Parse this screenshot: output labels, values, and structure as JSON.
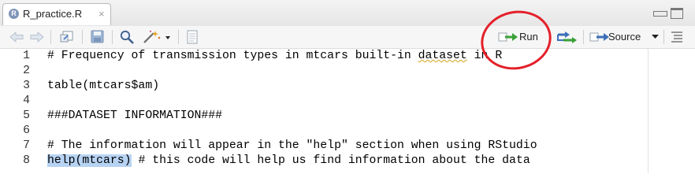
{
  "tab": {
    "filename": "R_practice.R",
    "close_glyph": "×",
    "icon_letter": "R"
  },
  "toolbar": {
    "run_label": "Run",
    "source_label": "Source"
  },
  "editor": {
    "lines": [
      {
        "num": "1",
        "pre": "# Frequency of transmission types in mtcars built-in ",
        "flag": "dataset",
        "post": " in R"
      },
      {
        "num": "2",
        "text": ""
      },
      {
        "num": "3",
        "text": "table(mtcars$am)"
      },
      {
        "num": "4",
        "text": ""
      },
      {
        "num": "5",
        "text": "###DATASET INFORMATION###"
      },
      {
        "num": "6",
        "text": ""
      },
      {
        "num": "7",
        "text": "# The information will appear in the \"help\" section when using RStudio"
      },
      {
        "num": "8",
        "sel": "help(mtcars)",
        "post": " # this code will help us find information about the data"
      }
    ]
  },
  "colors": {
    "annotation": "#e4202a",
    "selection": "#b7d3f3",
    "spell_underline": "#d6a318"
  },
  "icons": [
    "back-arrow-icon",
    "forward-arrow-icon",
    "show-in-window-icon",
    "save-icon",
    "find-icon",
    "code-tools-wand-icon",
    "compile-report-icon",
    "run-arrow-icon",
    "re-run-icon",
    "source-arrow-icon",
    "document-outline-icon",
    "minimize-icon",
    "maximize-icon"
  ]
}
